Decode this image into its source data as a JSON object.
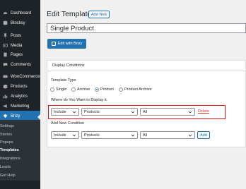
{
  "sidebar": {
    "items": [
      {
        "label": "Dashboard",
        "icon": "dashboard-icon"
      },
      {
        "label": "Blocksy",
        "icon": "blocksy-icon"
      },
      {
        "label": "Posts",
        "icon": "pin-icon"
      },
      {
        "label": "Media",
        "icon": "media-icon"
      },
      {
        "label": "Pages",
        "icon": "page-icon"
      },
      {
        "label": "Comments",
        "icon": "comment-icon"
      },
      {
        "label": "WooCommerce",
        "icon": "woocommerce-icon"
      },
      {
        "label": "Products",
        "icon": "products-icon"
      },
      {
        "label": "Analytics",
        "icon": "analytics-icon"
      },
      {
        "label": "Marketing",
        "icon": "megaphone-icon"
      },
      {
        "label": "Brizy",
        "icon": "brizy-icon"
      }
    ],
    "submenu": [
      "Settings",
      "Stories",
      "Popups",
      "Templates",
      "Integrations",
      "Leads",
      "Get Help"
    ]
  },
  "header": {
    "title": "Edit Template",
    "add_new": "Add New"
  },
  "title_value": "Single Product",
  "edit_button": "Edit with Brizy",
  "panel": {
    "title": "Display Conditions",
    "template_type_label": "Template Type",
    "types": [
      "Single",
      "Archive",
      "Product",
      "Product Archive"
    ],
    "selected_type": "Product",
    "where_label": "Where do You Want to Display it",
    "condition": {
      "mode": "Include",
      "entity": "Products",
      "scope": "All",
      "delete": "Delete"
    },
    "add_label": "Add New Condition",
    "new_condition": {
      "mode": "Include",
      "entity": "Products",
      "scope": "All",
      "add": "Add"
    }
  },
  "colors": {
    "sidebar_bg": "#1d2327",
    "accent": "#2271b1",
    "highlight": "#e10e0e",
    "delete": "#d63638"
  }
}
